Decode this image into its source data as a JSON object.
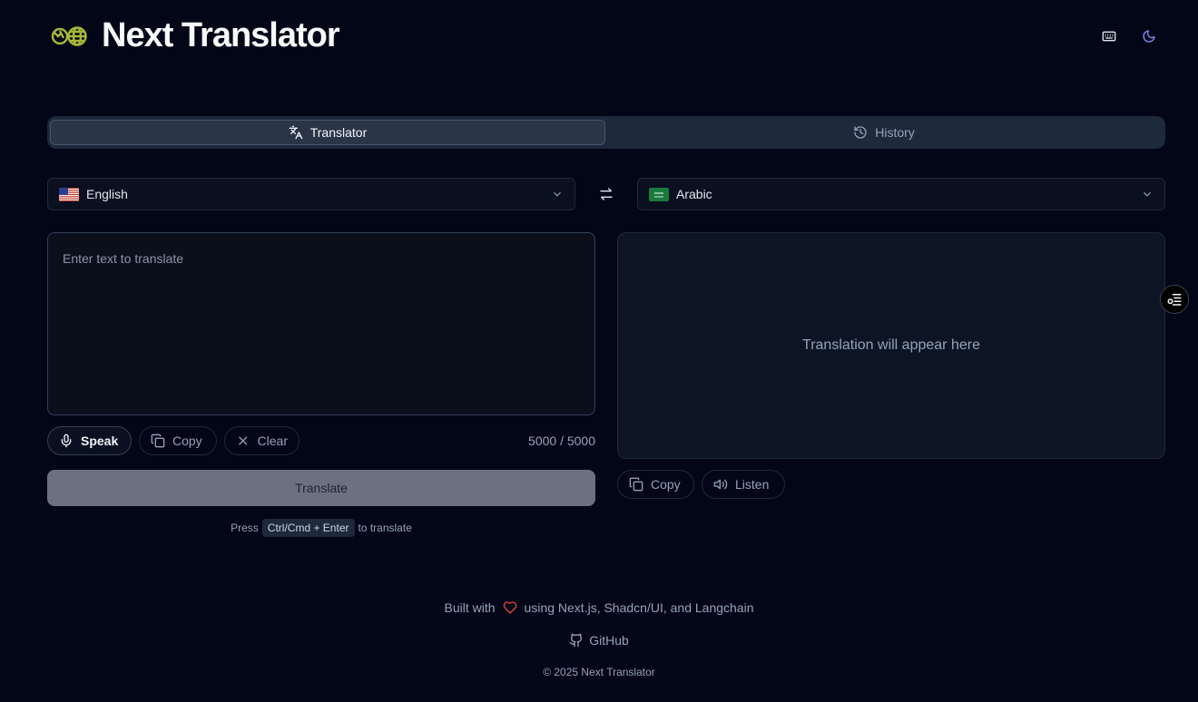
{
  "header": {
    "title": "Next Translator",
    "logo_icon": "globe-icon",
    "keyboard_icon": "keyboard-icon",
    "theme_icon": "moon-icon"
  },
  "tabs": [
    {
      "label": "Translator",
      "icon": "translate-icon",
      "active": true
    },
    {
      "label": "History",
      "icon": "history-icon",
      "active": false
    }
  ],
  "source_language": {
    "label": "English",
    "flag": "us-flag"
  },
  "target_language": {
    "label": "Arabic",
    "flag": "sa-flag"
  },
  "input": {
    "placeholder": "Enter text to translate"
  },
  "input_actions": {
    "speak": "Speak",
    "copy": "Copy",
    "clear": "Clear",
    "char_count": "5000 / 5000"
  },
  "output": {
    "placeholder": "Translation will appear here"
  },
  "output_actions": {
    "copy": "Copy",
    "listen": "Listen"
  },
  "translate_button": "Translate",
  "hint": {
    "prefix": "Press",
    "shortcut": "Ctrl/Cmd + Enter",
    "suffix": "to translate"
  },
  "footer": {
    "built_prefix": "Built with",
    "built_suffix": "using Next.js, Shadcn/UI, and Langchain",
    "github": "GitHub",
    "copyright": "© 2025 Next Translator"
  },
  "colors": {
    "background": "#030617",
    "accent_logo": "#a8b83a",
    "heart": "#ef4444",
    "moon": "#818cf8"
  }
}
